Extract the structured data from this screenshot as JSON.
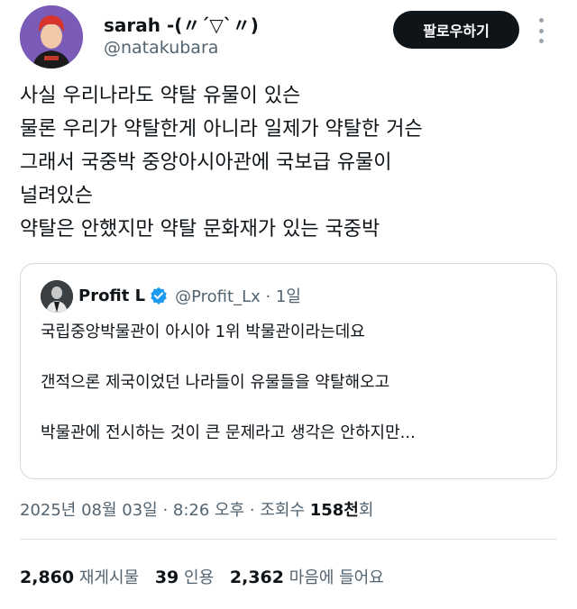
{
  "author": {
    "display_name": "sarah -(〃´▽`〃)",
    "handle": "@natakubara",
    "follow_label": "팔로우하기"
  },
  "tweet": {
    "lines": [
      "사실 우리나라도 약탈 유물이 있슨",
      "물론 우리가 약탈한게 아니라 일제가 약탈한 거슨",
      "그래서 국중박 중앙아시아관에 국보급 유물이",
      "널려있슨",
      "약탈은 안했지만 약탈 문화재가 있는 국중박"
    ]
  },
  "quote": {
    "name": "Profit L",
    "handle_time": "@Profit_Lx · 1일",
    "lines": [
      "국립중앙박물관이 아시아 1위 박물관이라는데요",
      "",
      "갠적으론 제국이었던 나라들이 유물들을 약탈해오고",
      "",
      "박물관에 전시하는 것이 큰 문제라고 생각은 안하지만..."
    ]
  },
  "meta": {
    "timestamp": "2025년 08월 03일 · 8:26 오후 · 조회수 ",
    "views": "158천",
    "views_suffix": "회"
  },
  "stats": {
    "retweets_count": "2,860",
    "retweets_label": "재게시물",
    "quotes_count": "39",
    "quotes_label": "인용",
    "likes_count": "2,362",
    "likes_label": "마음에 들어요"
  },
  "colors": {
    "text": "#0f1419",
    "secondary": "#536471",
    "verified": "#1d9bf0",
    "border": "#cfd9de"
  },
  "icons": {
    "more": "more-icon",
    "verified": "verified-badge-icon"
  }
}
